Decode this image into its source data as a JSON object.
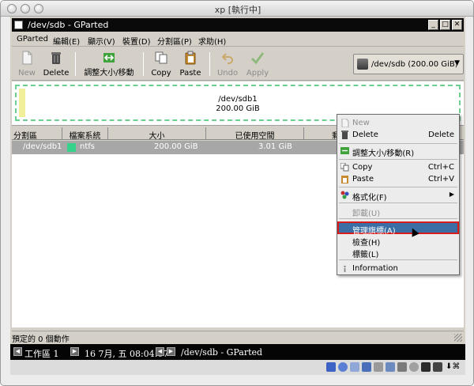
{
  "mac_window": {
    "title": "xp [執行中]"
  },
  "gparted": {
    "title": "/dev/sdb - GParted",
    "menu": [
      "GParted",
      "編輯(E)",
      "顯示(V)",
      "裝置(D)",
      "分割區(P)",
      "求助(H)"
    ],
    "toolbar": {
      "new": "New",
      "delete": "Delete",
      "resize": "調整大小/移動",
      "copy": "Copy",
      "paste": "Paste",
      "undo": "Undo",
      "apply": "Apply"
    },
    "device": "/dev/sdb   (200.00 GiB)",
    "disk_graphic": {
      "name": "/dev/sdb1",
      "size": "200.00 GiB"
    },
    "columns": [
      "分割區",
      "檔案系統",
      "大小",
      "已使用空間",
      "剩"
    ],
    "rows": [
      {
        "partition": "/dev/sdb1",
        "filesystem": "ntfs",
        "size": "200.00 GiB",
        "used": "3.01 GiB"
      }
    ],
    "status": "預定的 0 個動作"
  },
  "context_menu": {
    "new": "New",
    "delete": "Delete",
    "delete_acc": "Delete",
    "resize": "調整大小/移動(R)",
    "copy": "Copy",
    "copy_acc": "Ctrl+C",
    "paste": "Paste",
    "paste_acc": "Ctrl+V",
    "format": "格式化(F)",
    "unmount": "卸載(U)",
    "manage_flags": "管理旗標(A)",
    "check": "檢查(H)",
    "label": "標籤(L)",
    "information": "Information"
  },
  "taskbar": {
    "workspace": "工作區 1",
    "clock": "16 7月, 五 08:04:07",
    "window": "/dev/sdb - GParted"
  }
}
